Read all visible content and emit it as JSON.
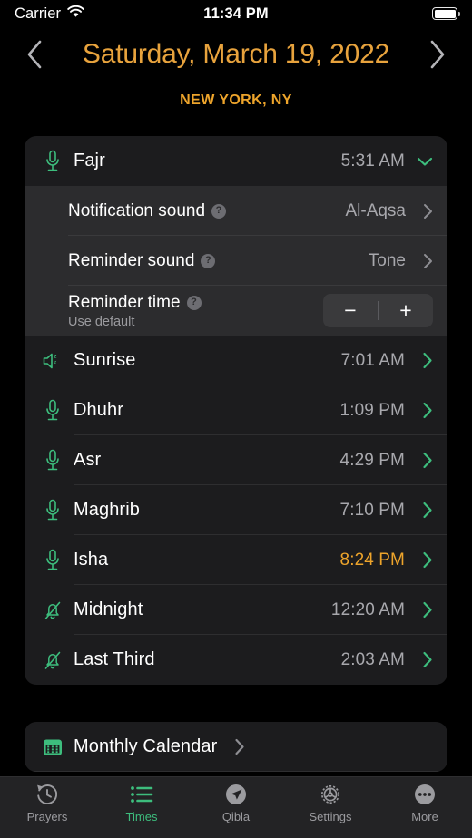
{
  "status_bar": {
    "carrier": "Carrier",
    "wifi_icon": "wifi-icon",
    "time": "11:34 PM",
    "battery_icon": "battery-full-icon"
  },
  "header": {
    "prev_icon": "chevron-left-icon",
    "next_icon": "chevron-right-icon",
    "date": "Saturday, March 19, 2022",
    "city": "NEW YORK, NY"
  },
  "colors": {
    "accent_orange": "#eda42b",
    "accent_green": "#3dbd7d",
    "card_bg": "#1c1c1e",
    "subrow_bg": "#2c2c2e",
    "secondary_text": "#a8a8ad"
  },
  "expanded_prayer": {
    "icon": "microphone-icon",
    "name": "Fajr",
    "time": "5:31 AM",
    "collapse_icon": "chevron-down-icon",
    "settings": [
      {
        "label": "Notification sound",
        "help_icon": "help-circle-icon",
        "value": "Al-Aqsa",
        "chevron_icon": "chevron-right-icon",
        "type": "link"
      },
      {
        "label": "Reminder sound",
        "help_icon": "help-circle-icon",
        "value": "Tone",
        "chevron_icon": "chevron-right-icon",
        "type": "link"
      },
      {
        "label": "Reminder time",
        "help_icon": "help-circle-icon",
        "sublabel": "Use default",
        "type": "stepper",
        "decrement_label": "−",
        "increment_label": "+"
      }
    ]
  },
  "prayers": [
    {
      "icon": "speaker-silent-icon",
      "name": "Sunrise",
      "time": "7:01 AM",
      "chevron_icon": "chevron-right-icon",
      "highlighted": false
    },
    {
      "icon": "microphone-icon",
      "name": "Dhuhr",
      "time": "1:09 PM",
      "chevron_icon": "chevron-right-icon",
      "highlighted": false
    },
    {
      "icon": "microphone-icon",
      "name": "Asr",
      "time": "4:29 PM",
      "chevron_icon": "chevron-right-icon",
      "highlighted": false
    },
    {
      "icon": "microphone-icon",
      "name": "Maghrib",
      "time": "7:10 PM",
      "chevron_icon": "chevron-right-icon",
      "highlighted": false
    },
    {
      "icon": "microphone-icon",
      "name": "Isha",
      "time": "8:24 PM",
      "chevron_icon": "chevron-right-icon",
      "highlighted": true
    },
    {
      "icon": "bell-slash-icon",
      "name": "Midnight",
      "time": "12:20 AM",
      "chevron_icon": "chevron-right-icon",
      "highlighted": false
    },
    {
      "icon": "bell-slash-icon",
      "name": "Last Third",
      "time": "2:03 AM",
      "chevron_icon": "chevron-right-icon",
      "highlighted": false
    }
  ],
  "calendar_row": {
    "icon": "calendar-icon",
    "label": "Monthly Calendar",
    "chevron_icon": "chevron-right-icon"
  },
  "tabs": [
    {
      "label": "Prayers",
      "icon": "clock-arrow-icon",
      "active": false
    },
    {
      "label": "Times",
      "icon": "list-icon",
      "active": true
    },
    {
      "label": "Qibla",
      "icon": "compass-arrow-icon",
      "active": false
    },
    {
      "label": "Settings",
      "icon": "gear-icon",
      "active": false
    },
    {
      "label": "More",
      "icon": "ellipsis-circle-icon",
      "active": false
    }
  ]
}
